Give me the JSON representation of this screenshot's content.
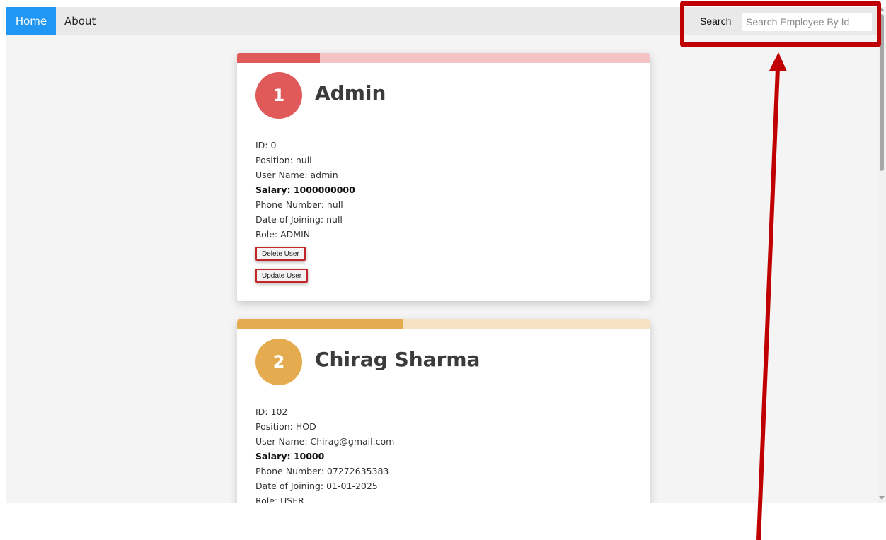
{
  "nav": {
    "home": "Home",
    "about": "About",
    "search_label": "Search",
    "search_placeholder": "Search Employee By Id",
    "search_value": ""
  },
  "employees": [
    {
      "index": "1",
      "name": "Admin",
      "color": "#e05a5a",
      "light_color": "#f4c3c3",
      "progress": 0.2,
      "id": "ID: 0",
      "position": "Position: null",
      "username": "User Name: admin",
      "salary": "Salary: 1000000000",
      "phone": "Phone Number: null",
      "joining": "Date of Joining: null",
      "role": "Role: ADMIN",
      "delete_label": "Delete User",
      "update_label": "Update User"
    },
    {
      "index": "2",
      "name": "Chirag Sharma",
      "color": "#e4ab4f",
      "light_color": "#f6e2c2",
      "progress": 0.4,
      "id": "ID: 102",
      "position": "Position: HOD",
      "username": "User Name: Chirag@gmail.com",
      "salary": "Salary: 10000",
      "phone": "Phone Number: 07272635383",
      "joining": "Date of Joining: 01-01-2025",
      "role": "Role: USER"
    }
  ],
  "annotation": {
    "color": "#c00000"
  }
}
